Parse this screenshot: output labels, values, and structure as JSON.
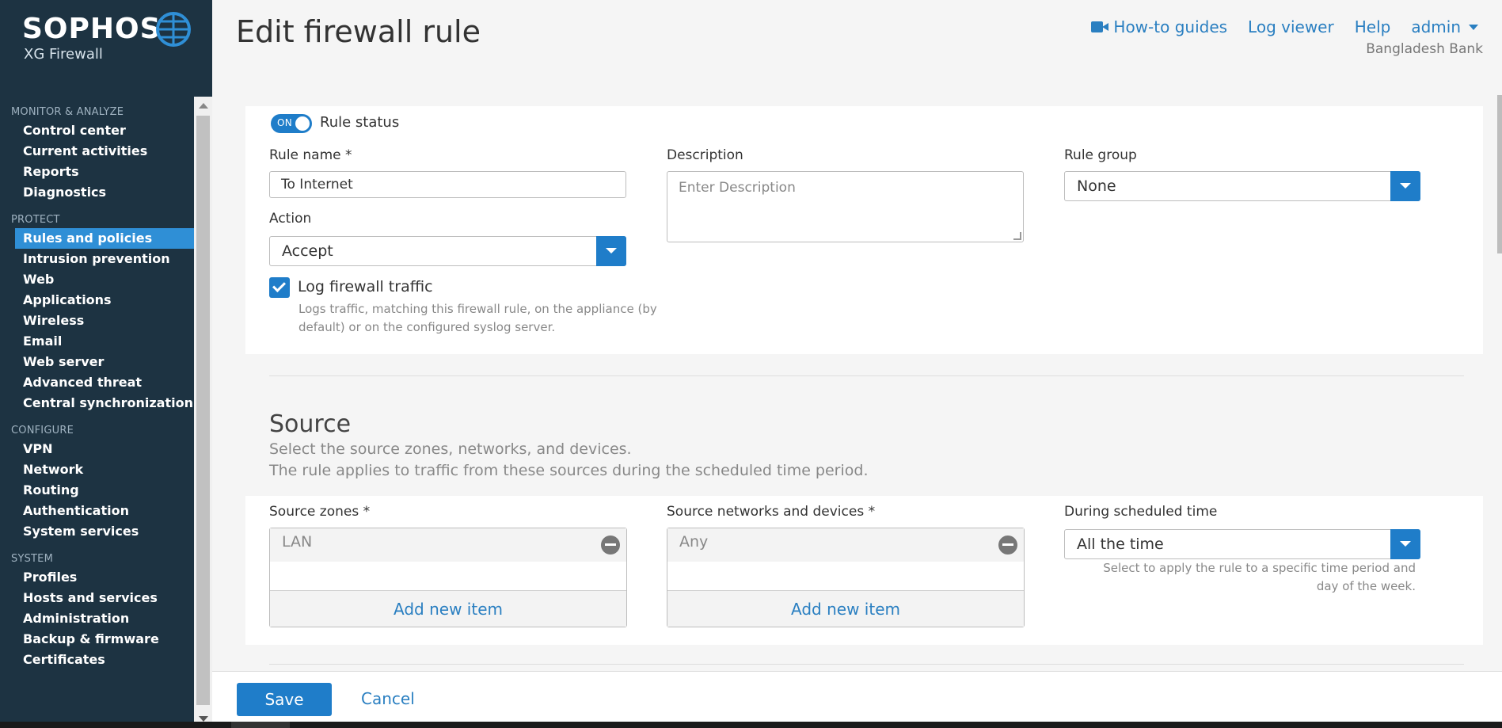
{
  "brand": {
    "name": "SOPHOS",
    "product": "XG Firewall"
  },
  "sidebar": {
    "sections": [
      {
        "title": "MONITOR & ANALYZE",
        "items": [
          "Control center",
          "Current activities",
          "Reports",
          "Diagnostics"
        ]
      },
      {
        "title": "PROTECT",
        "items": [
          "Rules and policies",
          "Intrusion prevention",
          "Web",
          "Applications",
          "Wireless",
          "Email",
          "Web server",
          "Advanced threat",
          "Central synchronization"
        ]
      },
      {
        "title": "CONFIGURE",
        "items": [
          "VPN",
          "Network",
          "Routing",
          "Authentication",
          "System services"
        ]
      },
      {
        "title": "SYSTEM",
        "items": [
          "Profiles",
          "Hosts and services",
          "Administration",
          "Backup & firmware",
          "Certificates"
        ]
      }
    ],
    "active_item": "Rules and policies"
  },
  "header": {
    "title": "Edit firewall rule",
    "links": {
      "guides": "How-to guides",
      "log_viewer": "Log viewer",
      "help": "Help",
      "user": "admin"
    },
    "organization": "Bangladesh Bank"
  },
  "general": {
    "toggle_label": "ON",
    "rule_status_label": "Rule status",
    "rule_name_label": "Rule name *",
    "rule_name_value": "To Internet",
    "description_label": "Description",
    "description_placeholder": "Enter Description",
    "rule_group_label": "Rule group",
    "rule_group_value": "None",
    "action_label": "Action",
    "action_value": "Accept",
    "log_traffic_label": "Log firewall traffic",
    "log_traffic_help_1": "Logs traffic, matching this firewall rule, on the appliance (by",
    "log_traffic_help_2": "default) or on the configured syslog server."
  },
  "source": {
    "title": "Source",
    "desc_1": "Select the source zones, networks, and devices.",
    "desc_2": "The rule applies to traffic from these sources during the scheduled time period.",
    "zones_label": "Source zones *",
    "zones_value": "LAN",
    "networks_label": "Source networks and devices *",
    "networks_value": "Any",
    "add_new_item": "Add new item",
    "schedule_label": "During scheduled time",
    "schedule_value": "All the time",
    "schedule_help_1": "Select to apply the rule to a specific time period and",
    "schedule_help_2": "day of the week."
  },
  "footer": {
    "save": "Save",
    "cancel": "Cancel"
  },
  "colors": {
    "sidebar_bg": "#1d3342",
    "accent": "#1f7dc9",
    "link": "#2a7fc1",
    "active_nav": "#2f8fd6"
  },
  "icons": {
    "logo": "globe-grid-icon",
    "guides": "video-camera-icon",
    "user_menu": "caret-down-icon",
    "remove": "minus-circle-icon",
    "dropdown": "caret-down-icon",
    "checkbox": "checkmark-icon"
  }
}
